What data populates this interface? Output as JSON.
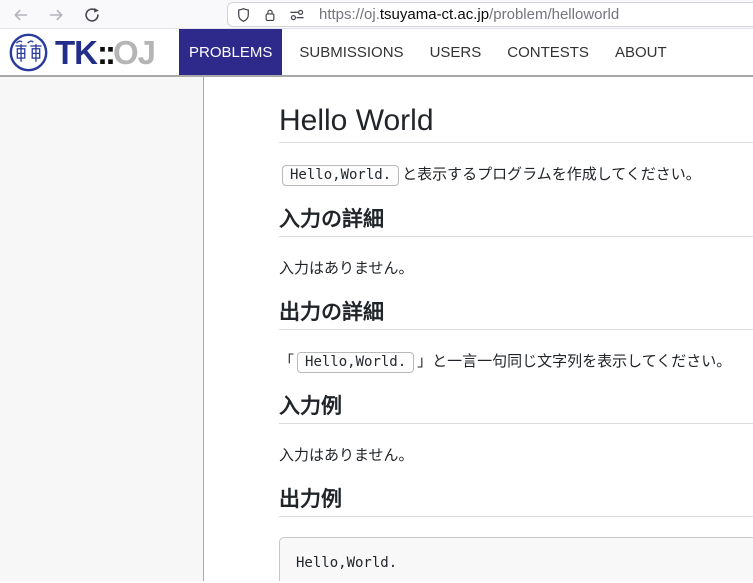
{
  "browser": {
    "url": {
      "scheme_and_subdomain": "https://oj.",
      "domain": "tsuyama-ct.ac.jp",
      "path": "/problem/helloworld"
    },
    "icons": {
      "back": "back-arrow-icon",
      "forward": "forward-arrow-icon",
      "reload": "reload-icon",
      "shield": "tracking-protection-shield-icon",
      "lock": "https-lock-icon",
      "permissions": "site-permissions-icon"
    }
  },
  "navbar": {
    "emblem": "tsuyama-college-emblem",
    "wordmark": {
      "tk": "TK",
      "separator": "::",
      "oj": "OJ"
    },
    "items": [
      {
        "label": "PROBLEMS",
        "active": true
      },
      {
        "label": "SUBMISSIONS",
        "active": false
      },
      {
        "label": "USERS",
        "active": false
      },
      {
        "label": "CONTESTS",
        "active": false
      },
      {
        "label": "ABOUT",
        "active": false
      }
    ]
  },
  "content": {
    "title": "Hello World",
    "intro": {
      "code": "Hello,World.",
      "text": "と表示するプログラムを作成してください。"
    },
    "input_details": {
      "heading": "入力の詳細",
      "body": "入力はありません。"
    },
    "output_details": {
      "heading": "出力の詳細",
      "prefix": "「",
      "code": "Hello,World.",
      "suffix": "」と一言一句同じ文字列を表示してください。"
    },
    "input_example": {
      "heading": "入力例",
      "body": "入力はありません。"
    },
    "output_example": {
      "heading": "出力例",
      "code_block": "Hello,World."
    }
  },
  "colors": {
    "nav_active_bg": "#2d2a8c",
    "brand_tk": "#232d8a",
    "brand_oj": "#b5b5b5",
    "emblem_blue": "#2b3a9e",
    "sidebar_bg": "#f7f7f7",
    "code_block_bg": "#f8f8f8",
    "toolbar_bg": "#f9f9fb"
  }
}
